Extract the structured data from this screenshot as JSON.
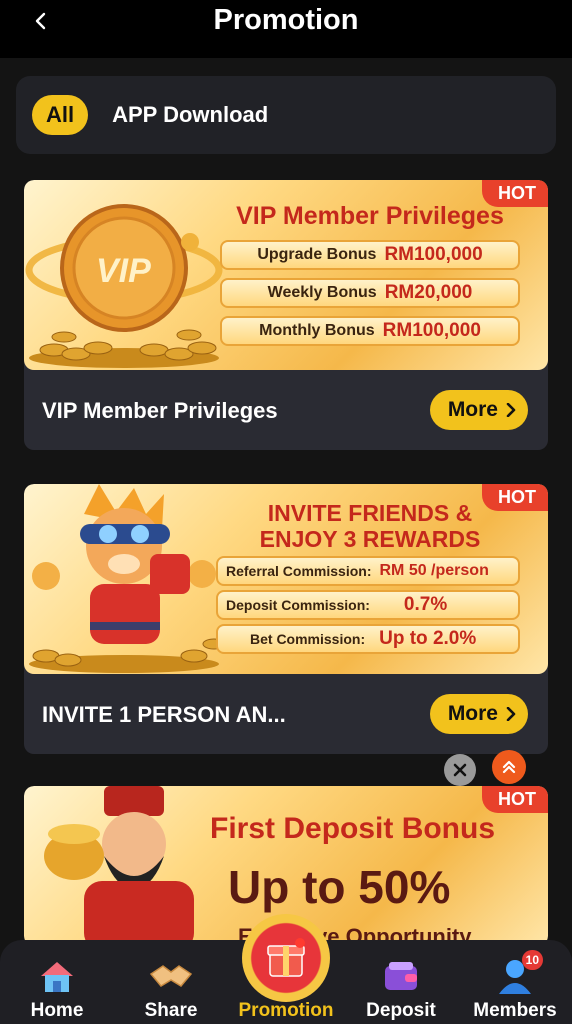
{
  "header": {
    "title": "Promotion"
  },
  "filters": {
    "all_label": "All",
    "app_download_label": "APP Download"
  },
  "cards": [
    {
      "hot": "HOT",
      "banner_heading": "VIP Member Privileges",
      "rows": [
        {
          "label": "Upgrade Bonus",
          "value": "RM100,000"
        },
        {
          "label": "Weekly Bonus",
          "value": "RM20,000"
        },
        {
          "label": "Monthly Bonus",
          "value": "RM100,000"
        }
      ],
      "badge_text": "VIP",
      "title": "VIP Member Privileges",
      "more_label": "More"
    },
    {
      "hot": "HOT",
      "banner_heading_line1": "INVITE FRIENDS &",
      "banner_heading_line2": "ENJOY 3 REWARDS",
      "rows": [
        {
          "label": "Referral Commission:",
          "value": "RM 50 /person"
        },
        {
          "label": "Deposit Commission:",
          "value": "0.7%"
        },
        {
          "label": "Bet Commission:",
          "value": "Up to 2.0%"
        }
      ],
      "title": "INVITE 1 PERSON AN...",
      "more_label": "More"
    },
    {
      "hot": "HOT",
      "banner_heading": "First Deposit Bonus",
      "banner_big": "Up to 50%",
      "banner_sub": "Exclusive Opportunity"
    }
  ],
  "nav": [
    {
      "label": "Home",
      "icon": "home-icon"
    },
    {
      "label": "Share",
      "icon": "handshake-icon"
    },
    {
      "label": "Promotion",
      "icon": "gift-icon"
    },
    {
      "label": "Deposit",
      "icon": "wallet-icon"
    },
    {
      "label": "Members",
      "icon": "user-icon",
      "badge": "10"
    }
  ],
  "colors": {
    "accent": "#f2c21c",
    "hot": "#e8412b",
    "card_bg": "#2a2b33"
  }
}
